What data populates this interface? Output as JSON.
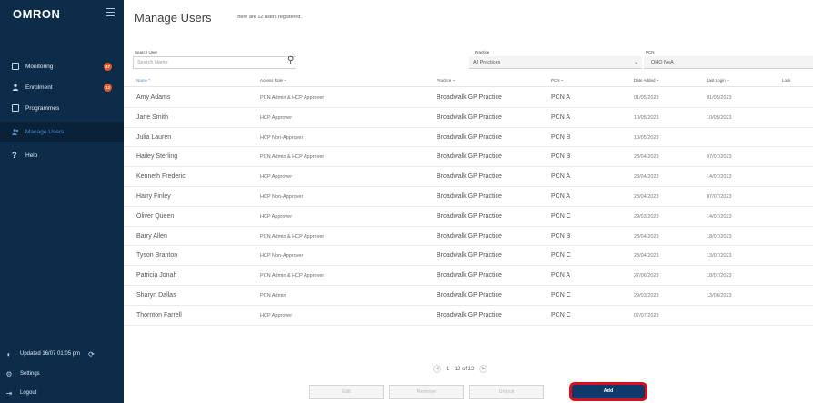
{
  "app": {
    "logo": "OMRON"
  },
  "sidebar": {
    "items": [
      {
        "label": "Monitoring",
        "icon": "monitor-icon",
        "badge": "47"
      },
      {
        "label": "Enrolment",
        "icon": "person-icon",
        "badge": "12"
      },
      {
        "label": "Programmes",
        "icon": "clipboard-icon",
        "badge": ""
      },
      {
        "label": "Manage Users",
        "icon": "users-icon",
        "badge": "",
        "active": true
      },
      {
        "label": "Help",
        "icon": "question-icon",
        "badge": ""
      }
    ],
    "updated": "Updated 16/07 01:05 pm",
    "settings": "Settings",
    "logout": "Logout",
    "badge_color": "#e2562c",
    "bg_color": "#0d2c4a"
  },
  "main": {
    "title": "Manage Users",
    "subtitle": "There are 12 users registered.",
    "search": {
      "label": "Search User",
      "placeholder": "Search Name"
    },
    "practice": {
      "label": "Practice",
      "value": "All Practices"
    },
    "pcn": {
      "label": "PCN",
      "value": "OHQ NeA"
    },
    "columns": [
      "Name ^",
      "Access Role ~",
      "Practice ~",
      "PCN ~",
      "Date Added ~",
      "Last Login ~",
      "Lock"
    ],
    "rows": [
      [
        "Amy Adams",
        "PCN Admin & HCP Approver",
        "Broadwalk GP Practice",
        "PCN A",
        "01/05/2023",
        "01/05/2023"
      ],
      [
        "Jane Smith",
        "HCP Approver",
        "Broadwalk GP Practice",
        "PCN A",
        "10/05/2023",
        "10/05/2023"
      ],
      [
        "Julia Lauren",
        "HCP Non-Approver",
        "Broadwalk GP Practice",
        "PCN B",
        "10/05/2023",
        ""
      ],
      [
        "Hailey Sterling",
        "PCN Admin & HCP Approver",
        "Broadwalk GP Practice",
        "PCN B",
        "28/04/2023",
        "07/07/2023"
      ],
      [
        "Kenneth Frederic",
        "HCP Approver",
        "Broadwalk GP Practice",
        "PCN A",
        "28/04/2023",
        "14/07/2023"
      ],
      [
        "Harry Finley",
        "HCP Non-Approver",
        "Broadwalk GP Practice",
        "PCN A",
        "28/04/2023",
        "07/07/2023"
      ],
      [
        "Oliver Queen",
        "HCP Approver",
        "Broadwalk GP Practice",
        "PCN C",
        "29/03/2023",
        "14/07/2023"
      ],
      [
        "Barry Allen",
        "PCN Admin & HCP Approver",
        "Broadwalk GP Practice",
        "PCN B",
        "28/04/2023",
        "18/07/2023"
      ],
      [
        "Tyson Branton",
        "HCP Non-Approver",
        "Broadwalk GP Practice",
        "PCN C",
        "28/04/2023",
        "13/07/2023"
      ],
      [
        "Patricia Jonah",
        "PCN Admin & HCP Approver",
        "Broadwalk GP Practice",
        "PCN A",
        "27/06/2023",
        "18/07/2023"
      ],
      [
        "Sharyn Dallas",
        "PCN Admin",
        "Broadwalk GP Practice",
        "PCN C",
        "29/03/2023",
        "13/06/2023"
      ],
      [
        "Thornton Farrell",
        "HCP Approver",
        "Broadwalk GP Practice",
        "PCN C",
        "07/07/2023",
        ""
      ]
    ],
    "pager": "1 - 12 of 12",
    "buttons": {
      "edit": "Edit",
      "remove": "Remove",
      "unlock": "Unlock",
      "add": "Add"
    },
    "accent_color": "#0e3a6b",
    "highlight_color": "#d9101b"
  }
}
